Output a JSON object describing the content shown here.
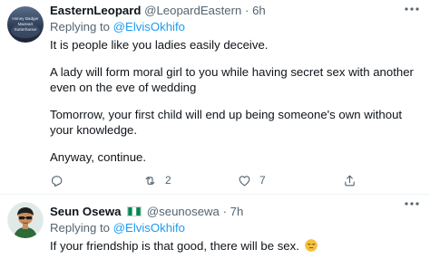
{
  "tweet1": {
    "display_name": "EasternLeopard",
    "handle": "@LeopardEastern",
    "separator": "·",
    "time": "6h",
    "replying_prefix": "Replying to ",
    "replying_to": "@ElvisOkhifo",
    "avatar_caption_line1": "Honey Badger",
    "avatar_caption_line2": "Mazeart",
    "avatar_caption_line3": "Sutterhanse",
    "paragraphs": [
      "It is people like you ladies easily deceive.",
      "A lady will form moral girl to you while having secret sex with another even on the eve of wedding",
      "Tomorrow, your first child will end up being someone's own without your knowledge.",
      "Anyway, continue."
    ],
    "actions": {
      "reply_icon": "reply-icon",
      "retweet_icon": "retweet-icon",
      "retweet_count": "2",
      "like_icon": "heart-icon",
      "like_count": "7",
      "share_icon": "share-icon"
    }
  },
  "tweet2": {
    "display_name": "Seun Osewa",
    "flag_icon": "nigeria-flag-icon",
    "handle": "@seunosewa",
    "separator": "·",
    "time": "7h",
    "replying_prefix": "Replying to ",
    "replying_to": "@ElvisOkhifo",
    "text": "If your friendship is that good, there will be sex.",
    "emoji": "unamused-face-emoji"
  },
  "colors": {
    "text_primary": "#0f1419",
    "text_secondary": "#536471",
    "accent": "#1d9bf0",
    "divider": "#eff3f4",
    "flag_green": "#008751"
  }
}
